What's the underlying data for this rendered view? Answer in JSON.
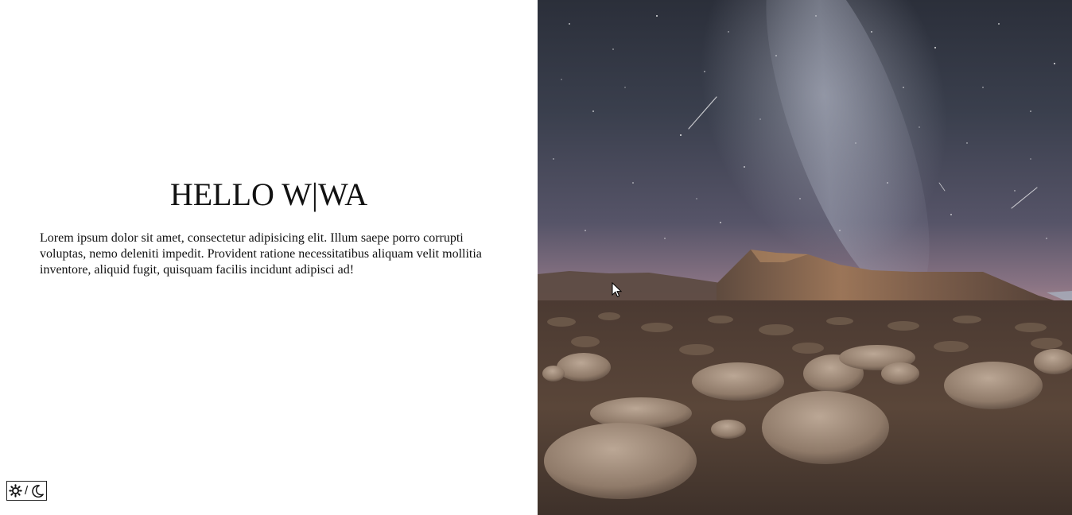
{
  "hero": {
    "heading": "HELLO W|WA",
    "paragraph": "Lorem ipsum dolor sit amet, consectetur adipisicing elit. Illum saepe porro corrupti voluptas, nemo deleniti impedit. Provident ratione necessitatibus aliquam velit mollitia inventore, aliquid fugit, quisquam facilis incidunt adipisci ad!"
  },
  "theme_toggle": {
    "separator": "/",
    "light_icon": "sun-icon",
    "dark_icon": "moon-icon"
  },
  "image": {
    "subject": "night-sky-desert-mesa-photo",
    "colors": {
      "sky_top": "#2e3340",
      "sky_horizon": "#7d6f80",
      "mesa": "#7a5c48",
      "ground": "#4a3a30"
    }
  }
}
